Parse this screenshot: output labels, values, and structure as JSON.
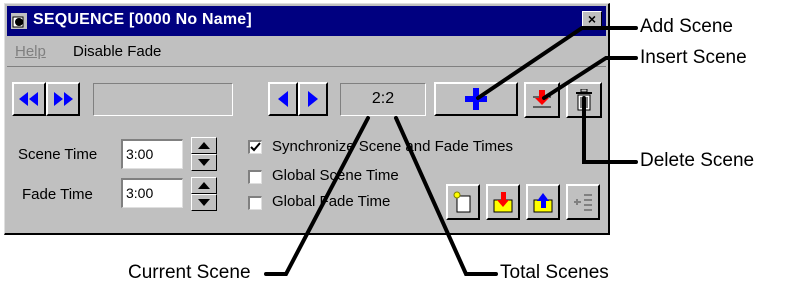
{
  "window": {
    "title": "SEQUENCE [0000 No Name]",
    "close_glyph": "×"
  },
  "menu": {
    "help": "Help",
    "disable_fade": "Disable Fade"
  },
  "toolbar": {
    "counter": "2:2"
  },
  "scene_time": {
    "label": "Scene Time",
    "value": "3:00"
  },
  "fade_time": {
    "label": "Fade Time",
    "value": "3:00"
  },
  "checks": {
    "sync_label": "Synchronize Scene and Fade Times",
    "sync_checked": true,
    "global_scene_label": "Global Scene Time",
    "global_scene_checked": false,
    "global_fade_label": "Global Fade Time",
    "global_fade_checked": false
  },
  "callouts": {
    "add_scene": "Add Scene",
    "insert_scene": "Insert Scene",
    "delete_scene": "Delete Scene",
    "current_scene": "Current Scene",
    "total_scenes": "Total Scenes"
  },
  "colors": {
    "titlebar": "#000080",
    "face": "#c0c0c0",
    "arrow_blue": "#0000ff",
    "insert_red": "#ff0000"
  }
}
